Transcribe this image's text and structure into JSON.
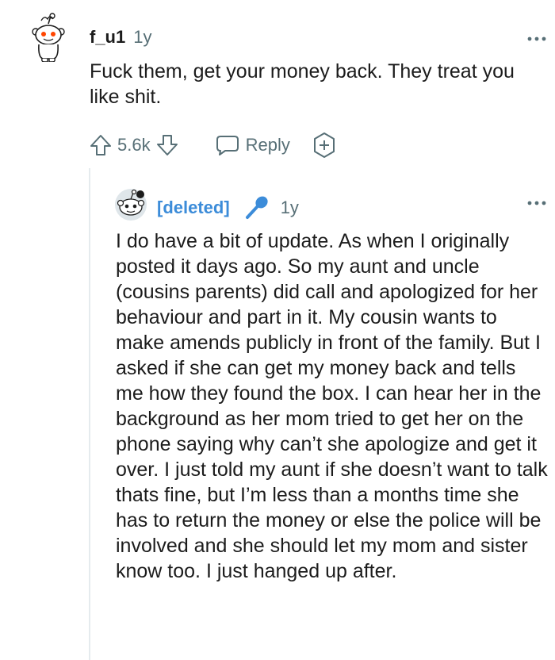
{
  "comment": {
    "username": "f_u1",
    "age": "1y",
    "text": "Fuck them, get your money back. They treat you like shit.",
    "votes": "5.6k",
    "reply_label": "Reply",
    "avatar_icon": "snoo-avatar-icon"
  },
  "reply": {
    "username": "[deleted]",
    "age": "1y",
    "text": "I do have a bit of update. As when I originally posted it days ago. So my aunt and uncle (cousins parents) did call and apologized for her behaviour and part in it. My cousin wants to make amends publicly in front of the family. But I asked if she can get my money back and tells me how they found the box. I can hear her in the background as her mom tried to get her on the phone saying why can’t she apologize and get it over. I just told my aunt if she doesn’t want to talk thats fine, but I’m less than a months time she has to return the money or else the police will be involved and she should let my mom and sister know too. I just hanged up after.",
    "badge_icon": "microphone-icon"
  },
  "colors": {
    "text": "#1c1c1c",
    "meta": "#576f76",
    "deleted": "#3c8cd9",
    "thread_line": "#e5ebee"
  }
}
